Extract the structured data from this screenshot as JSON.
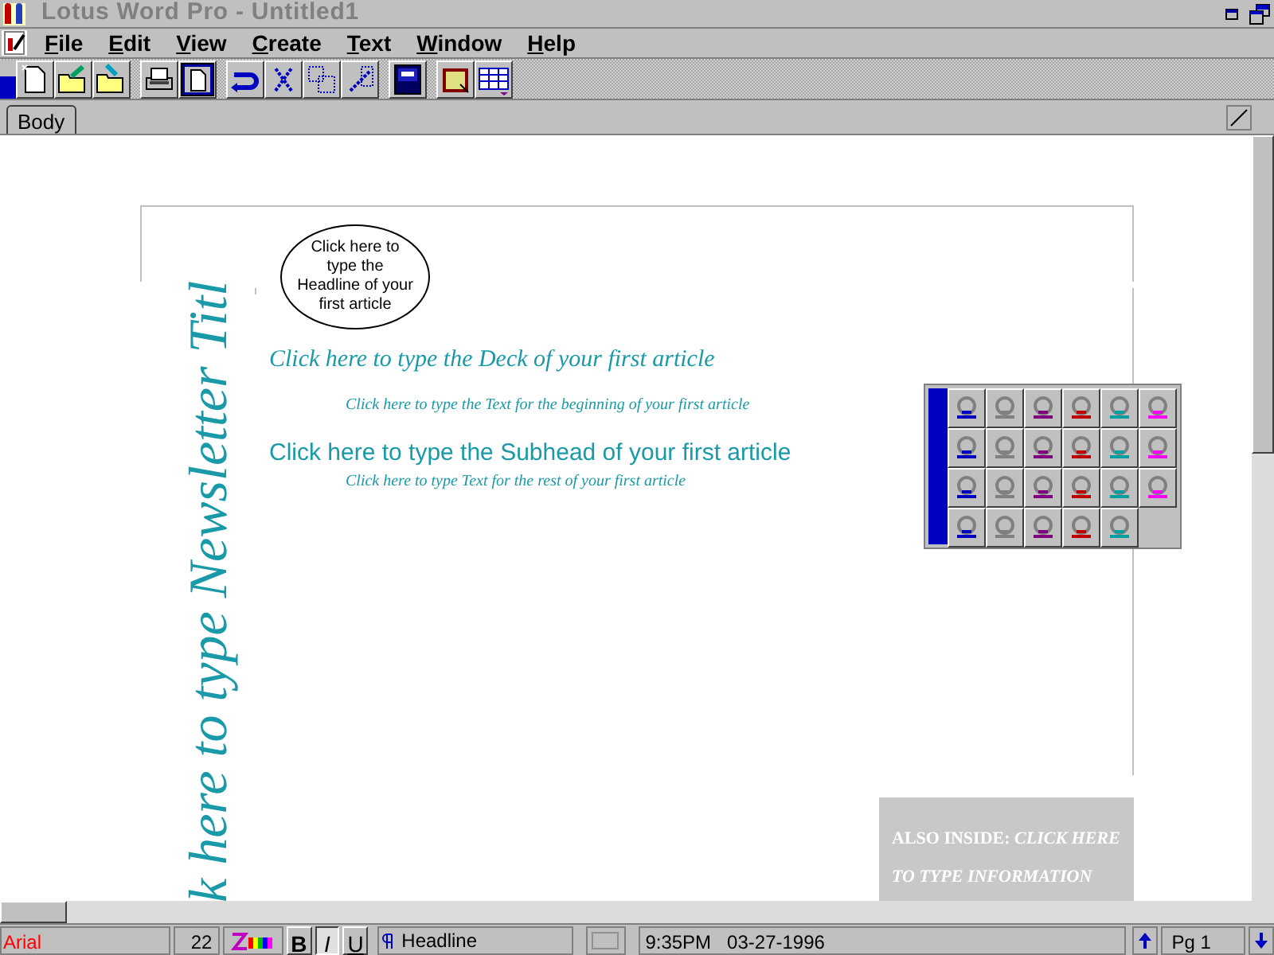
{
  "window": {
    "title": "Lotus Word Pro - Untitled1"
  },
  "menu": [
    {
      "label": "File"
    },
    {
      "label": "Edit"
    },
    {
      "label": "View"
    },
    {
      "label": "Create"
    },
    {
      "label": "Text"
    },
    {
      "label": "Window"
    },
    {
      "label": "Help"
    }
  ],
  "tabs": [
    {
      "label": "Body",
      "selected": true
    }
  ],
  "document": {
    "headline_callout": "Click here to type the Headline of your first article",
    "vertical_title": "k here to type Newsletter Titl",
    "deck": "Click here to type the Deck of your first article",
    "text_beginning": "Click here to type the Text for the beginning of your first article",
    "subhead": "Click here to type the Subhead of your first article",
    "text_rest": "Click here to type Text for the rest of your first article",
    "sidebar": "ALSO INSIDE: *CLICK HERE TO TYPE INFORMATION*"
  },
  "status_bar": {
    "font": "Arial",
    "size": "22",
    "styles": [
      {
        "label": "B",
        "on": false
      },
      {
        "label": "I",
        "on": true
      },
      {
        "label": "U",
        "on": false
      }
    ],
    "paragraph_style": "Headline",
    "datetime": "9:35PM   03-27-1996",
    "page": "Pg 1"
  }
}
